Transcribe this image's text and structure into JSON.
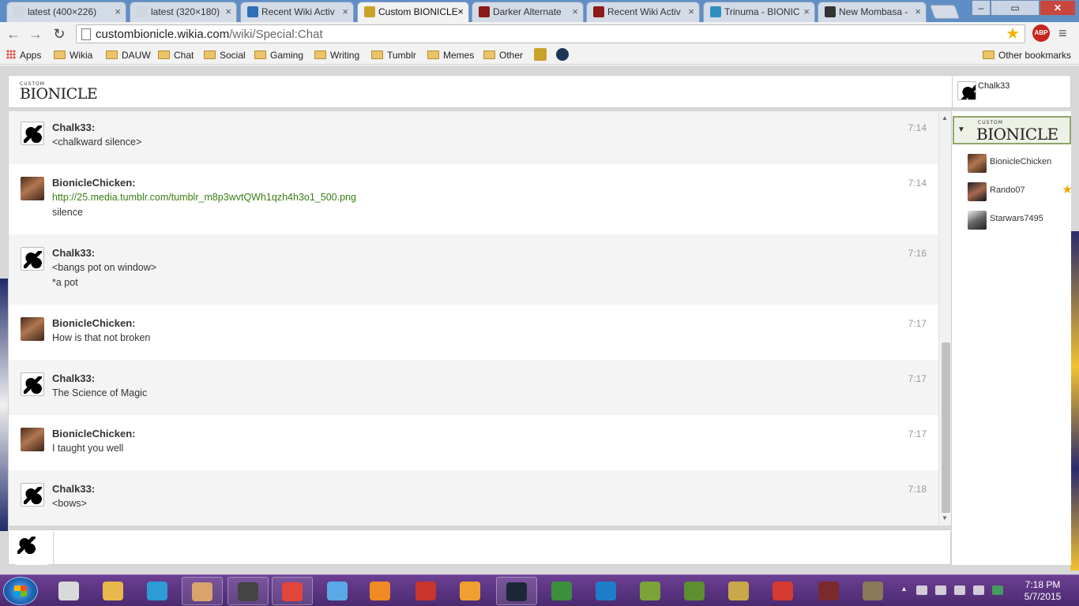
{
  "browser": {
    "tabs": [
      {
        "title": "latest (400×226)",
        "active": false,
        "favicon_color": "#cfd6e0"
      },
      {
        "title": "latest (320×180)",
        "active": false,
        "favicon_color": "#cfd6e0"
      },
      {
        "title": "Recent Wiki Activ",
        "active": false,
        "favicon_color": "#2f6fb5"
      },
      {
        "title": "Custom BIONICLE",
        "active": true,
        "favicon_color": "#c9a22c"
      },
      {
        "title": "Darker Alternate",
        "active": false,
        "favicon_color": "#8b1a1a"
      },
      {
        "title": "Recent Wiki Activ",
        "active": false,
        "favicon_color": "#8b1a1a"
      },
      {
        "title": "Trinuma - BIONIC",
        "active": false,
        "favicon_color": "#2f8fc0"
      },
      {
        "title": "New Mombasa -",
        "active": false,
        "favicon_color": "#333333"
      }
    ],
    "tab_close_glyph": "×",
    "url_domain": "custombionicle.wikia.com",
    "url_path": "/wiki/Special:Chat",
    "abp_label": "ABP",
    "bookmarks": [
      {
        "label": "Apps",
        "icon": "apps-icon"
      },
      {
        "label": "Wikia",
        "icon": "folder-icon"
      },
      {
        "label": "DAUW",
        "icon": "folder-icon"
      },
      {
        "label": "Chat",
        "icon": "folder-icon"
      },
      {
        "label": "Social",
        "icon": "folder-icon"
      },
      {
        "label": "Gaming",
        "icon": "folder-icon"
      },
      {
        "label": "Writing",
        "icon": "folder-icon"
      },
      {
        "label": "Tumblr",
        "icon": "folder-icon"
      },
      {
        "label": "Memes",
        "icon": "folder-icon"
      },
      {
        "label": "Other",
        "icon": "folder-icon"
      }
    ],
    "other_bookmarks": "Other bookmarks"
  },
  "chat": {
    "logo_small": "CUSTOM",
    "logo_main": "BIONICLE",
    "current_user": "Chalk33",
    "messages": [
      {
        "user": "Chalk33:",
        "time": "7:14",
        "lines": [
          "<chalkward silence>"
        ],
        "avatar": "bw"
      },
      {
        "user": "BionicleChicken:",
        "time": "7:14",
        "lines": [
          "http://25.media.tumblr.com/tumblr_m8p3wvtQWh1qzh4h3o1_500.png",
          "silence"
        ],
        "link_first": true,
        "avatar": "photo"
      },
      {
        "user": "Chalk33:",
        "time": "7:16",
        "lines": [
          "<bangs pot on window>",
          "*a pot"
        ],
        "avatar": "bw"
      },
      {
        "user": "BionicleChicken:",
        "time": "7:17",
        "lines": [
          "How is that not broken"
        ],
        "avatar": "photo"
      },
      {
        "user": "Chalk33:",
        "time": "7:17",
        "lines": [
          "The Science of Magic"
        ],
        "avatar": "bw"
      },
      {
        "user": "BionicleChicken:",
        "time": "7:17",
        "lines": [
          "I taught you well"
        ],
        "avatar": "photo"
      },
      {
        "user": "Chalk33:",
        "time": "7:18",
        "lines": [
          "<bows>"
        ],
        "avatar": "bw"
      }
    ],
    "users": [
      {
        "name": "BionicleChicken",
        "avatar": "photo",
        "moderator": false
      },
      {
        "name": "Rando07",
        "avatar": "rando",
        "moderator": true
      },
      {
        "name": "Starwars7495",
        "avatar": "star",
        "moderator": false
      }
    ],
    "input_value": ""
  },
  "taskbar": {
    "time": "7:18 PM",
    "date": "5/7/2015"
  }
}
